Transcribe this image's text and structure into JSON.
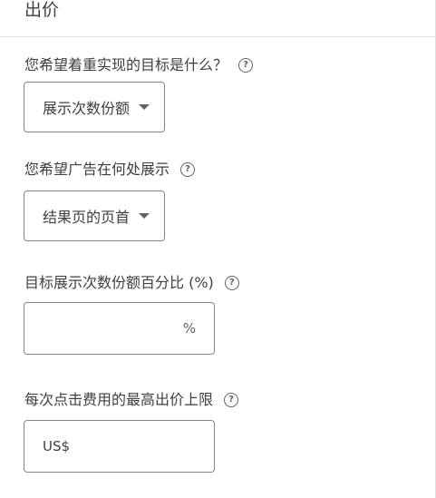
{
  "header": {
    "title": "出价"
  },
  "fields": {
    "goal": {
      "label": "您希望着重实现的目标是什么？",
      "value": "展示次数份额"
    },
    "location": {
      "label": "您希望广告在何处展示",
      "value": "结果页的页首"
    },
    "impression_share": {
      "label": "目标展示次数份额百分比 (%)",
      "value": "",
      "suffix": "%"
    },
    "max_cpc": {
      "label": "每次点击费用的最高出价上限",
      "value": "",
      "prefix": "US$"
    }
  },
  "help_glyph": "?",
  "icons": {
    "help": "help-circle-icon",
    "dropdown": "arrow-drop-down-icon"
  },
  "colors": {
    "text": "#3c4043",
    "border": "#80868b",
    "icon": "#5f6368",
    "divider": "#e0e0e0"
  }
}
